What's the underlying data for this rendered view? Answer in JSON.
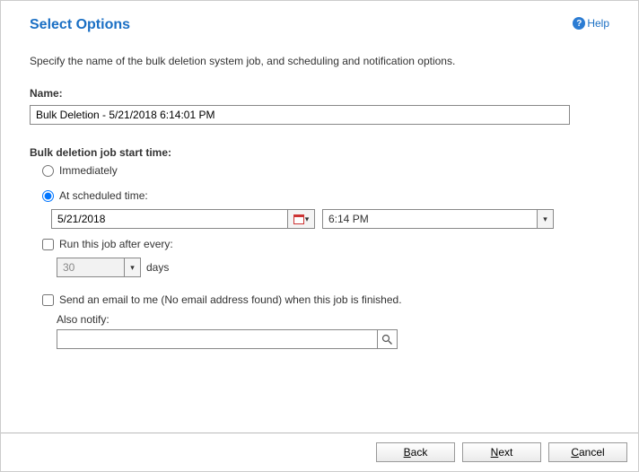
{
  "header": {
    "title": "Select Options",
    "help_label": "Help"
  },
  "description": "Specify the name of the bulk deletion system job, and scheduling and notification options.",
  "name": {
    "label": "Name:",
    "value": "Bulk Deletion - 5/21/2018 6:14:01 PM"
  },
  "start_time": {
    "label": "Bulk deletion job start time:",
    "option_immediately": "Immediately",
    "option_scheduled": "At scheduled time:",
    "date_value": "5/21/2018",
    "time_value": "6:14 PM",
    "recur_label": "Run this job after every:",
    "recur_value": "30",
    "recur_unit": "days"
  },
  "notify": {
    "email_label": "Send an email to me (No email address found) when this job is finished.",
    "also_label": "Also notify:",
    "value": ""
  },
  "footer": {
    "back": "ack",
    "back_u": "B",
    "next": "ext",
    "next_u": "N",
    "cancel": "ancel",
    "cancel_u": "C"
  }
}
